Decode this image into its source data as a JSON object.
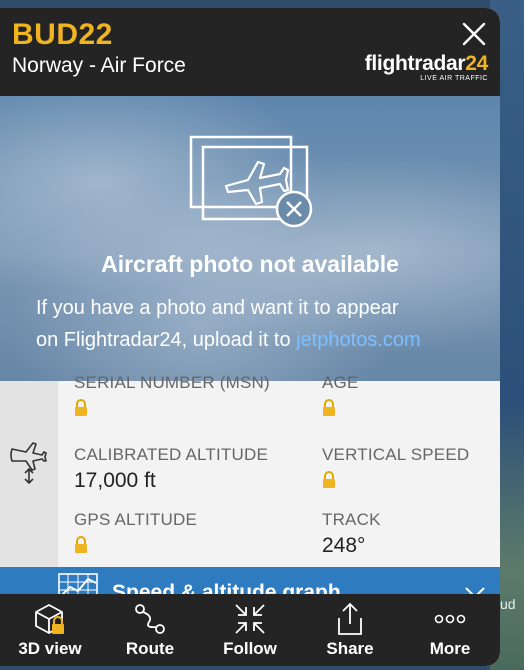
{
  "flight": {
    "callsign": "BUD22",
    "operator": "Norway - Air Force"
  },
  "logo": {
    "name": "flightradar",
    "number": "24",
    "tagline": "LIVE AIR TRAFFIC"
  },
  "photo": {
    "title": "Aircraft photo not available",
    "text_line1": "If you have a photo and want it to appear",
    "text_line2": "on Flightradar24, upload it to ",
    "link": "jetphotos.com"
  },
  "details": {
    "serial_label": "SERIAL NUMBER (MSN)",
    "age_label": "AGE",
    "calibrated_altitude_label": "CALIBRATED ALTITUDE",
    "calibrated_altitude_value": "17,000 ft",
    "vertical_speed_label": "VERTICAL SPEED",
    "gps_altitude_label": "GPS ALTITUDE",
    "track_label": "TRACK",
    "track_value": "248°"
  },
  "graph": {
    "label": "Speed & altitude graph"
  },
  "toolbar": [
    {
      "label": "3D view",
      "icon": "cube-lock-icon"
    },
    {
      "label": "Route",
      "icon": "route-icon"
    },
    {
      "label": "Follow",
      "icon": "follow-arrows-icon"
    },
    {
      "label": "Share",
      "icon": "share-icon"
    },
    {
      "label": "More",
      "icon": "more-dots-icon"
    }
  ],
  "map": {
    "label": "ud"
  },
  "colors": {
    "accent": "#f0b420",
    "header": "#242424",
    "graph_bar": "#2f7bbf",
    "link": "#7cc0ff"
  }
}
